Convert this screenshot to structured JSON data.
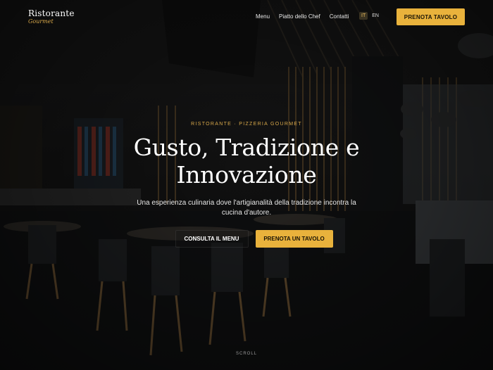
{
  "brand": {
    "name": "Ristorante",
    "tagline": "Gourmet"
  },
  "nav": {
    "items": [
      "Menu",
      "Piatto dello Chef",
      "Contatti"
    ]
  },
  "languages": {
    "items": [
      "IT",
      "EN"
    ],
    "active": "IT"
  },
  "header": {
    "book_label": "PRENOTA TAVOLO"
  },
  "hero": {
    "eyebrow": "RISTORANTE · PIZZERIA GOURMET",
    "title": "Gusto, Tradizione e Innovazione",
    "subtitle": "Una esperienza culinaria dove l'artigianalità della tradizione incontra la cucina d'autore.",
    "menu_button": "CONSULTA IL MENU",
    "book_button": "PRENOTA UN TAVOLO",
    "scroll_label": "SCROLL"
  },
  "colors": {
    "accent": "#e9b23c",
    "accent_text": "#d8a84a",
    "background": "#0e0f10"
  }
}
